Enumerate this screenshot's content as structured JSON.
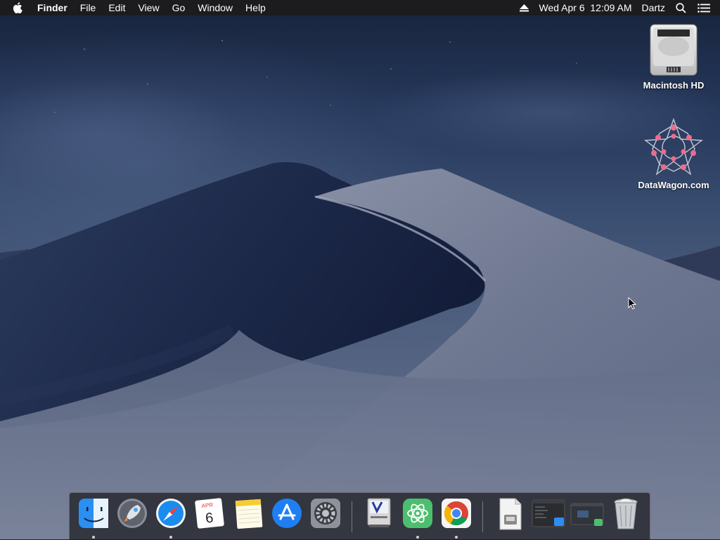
{
  "menubar": {
    "apple_icon": "apple-logo-icon",
    "app_name": "Finder",
    "menus": [
      "File",
      "Edit",
      "View",
      "Go",
      "Window",
      "Help"
    ],
    "status": {
      "eject_icon": "eject-icon",
      "datetime": "Wed Apr 6  12:09 AM",
      "user": "Dartz",
      "search_icon": "spotlight-search-icon",
      "notification_icon": "notification-center-icon"
    }
  },
  "desktop": {
    "icons": [
      {
        "label": "Macintosh HD",
        "icon": "hard-drive-icon"
      },
      {
        "label": "DataWagon.com",
        "icon": "network-star-icon"
      }
    ]
  },
  "dock": {
    "apps": [
      {
        "name": "Finder",
        "icon": "finder-icon",
        "running": true
      },
      {
        "name": "Launchpad",
        "icon": "launchpad-icon",
        "running": false
      },
      {
        "name": "Safari",
        "icon": "safari-icon",
        "running": true
      },
      {
        "name": "Calendar",
        "icon": "calendar-icon",
        "running": false,
        "month": "APR",
        "day": "6"
      },
      {
        "name": "Notes",
        "icon": "notes-icon",
        "running": false
      },
      {
        "name": "App Store",
        "icon": "app-store-icon",
        "running": false
      },
      {
        "name": "System Preferences",
        "icon": "system-preferences-icon",
        "running": false
      },
      {
        "name": "VMware",
        "icon": "vm-monitor-icon",
        "running": false
      },
      {
        "name": "Atom",
        "icon": "atom-icon",
        "running": true
      },
      {
        "name": "Google Chrome",
        "icon": "chrome-icon",
        "running": true
      }
    ],
    "others": [
      {
        "name": "Document",
        "icon": "document-icon"
      },
      {
        "name": "Window thumbnail 1",
        "icon": "window-thumbnail-icon"
      },
      {
        "name": "Window thumbnail 2",
        "icon": "window-thumbnail-icon"
      },
      {
        "name": "Trash",
        "icon": "trash-icon"
      }
    ]
  },
  "colors": {
    "menubar_bg": "#1c1c1e",
    "sky_top": "#17233b",
    "dune_dark": "#141f3b",
    "dune_light": "#9aa3b8"
  }
}
